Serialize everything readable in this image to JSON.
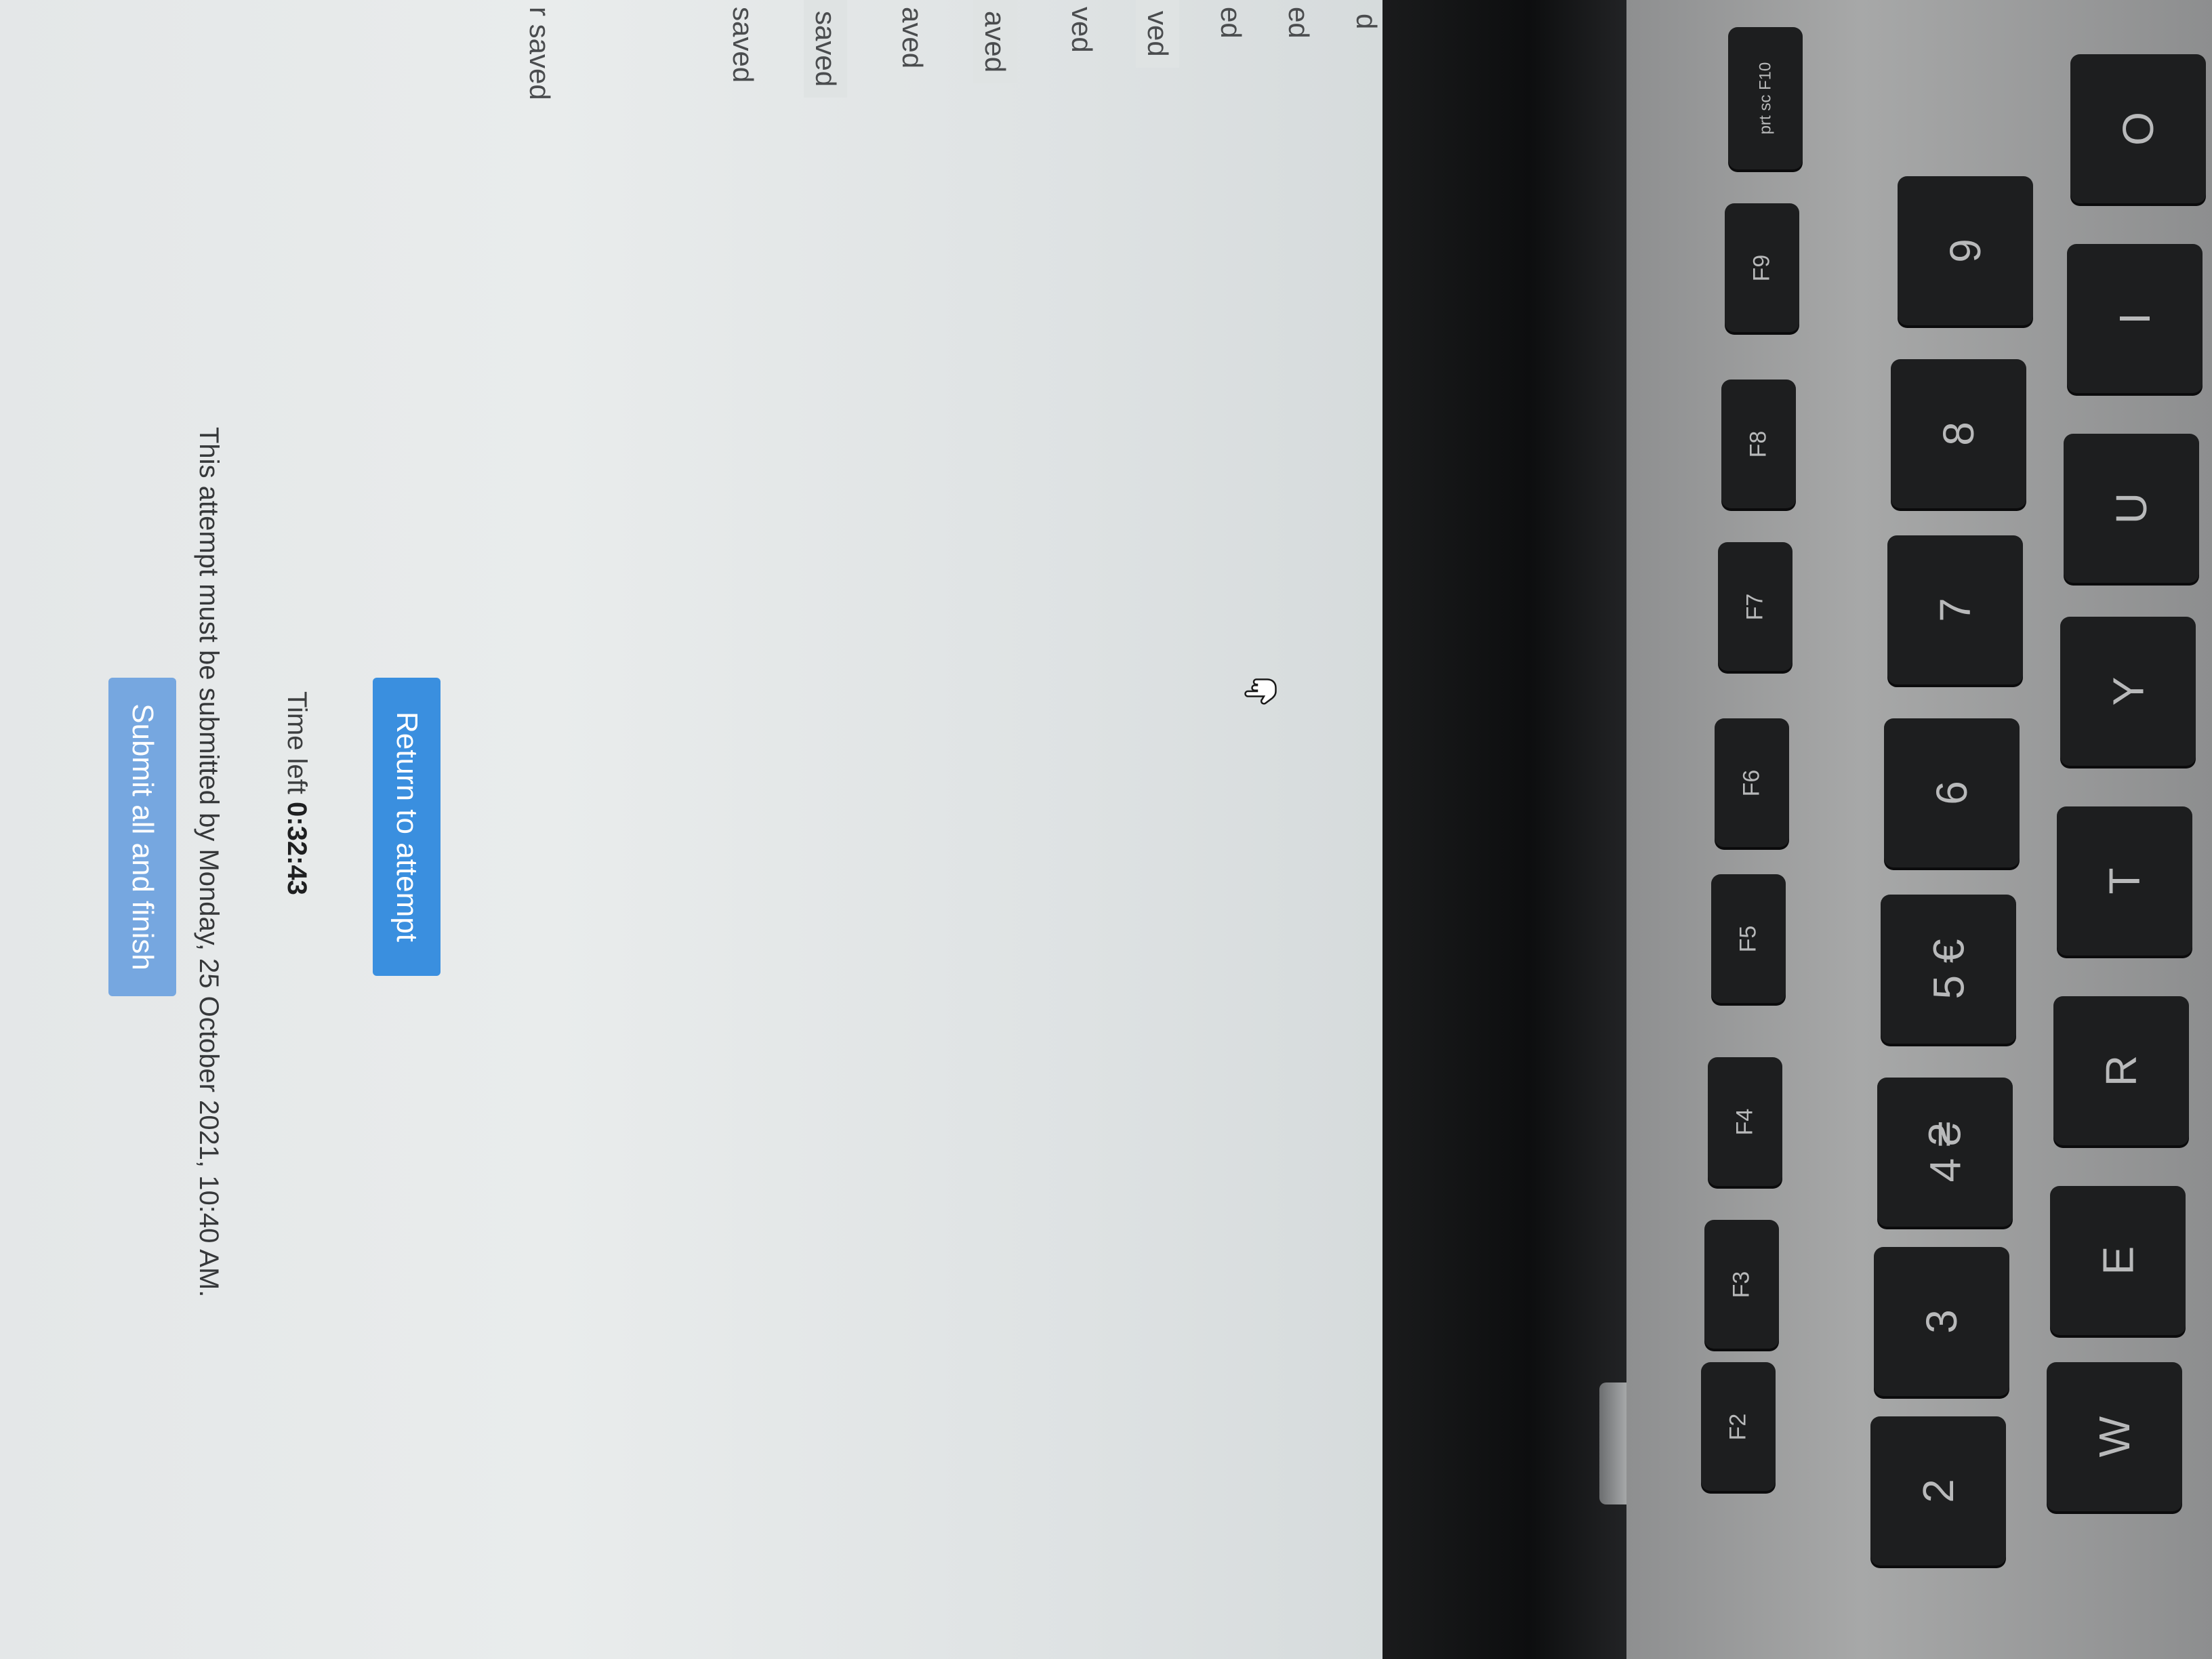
{
  "sidebar": {
    "items": [
      "d",
      "ed",
      "ed",
      "ved",
      "ved",
      "aved",
      "aved",
      "saved",
      "saved",
      "r saved"
    ]
  },
  "main": {
    "return_button": "Return to attempt",
    "time_left_label": "Time left",
    "time_left_value": "0:32:43",
    "submit_button": "Submit all and finish",
    "deadline_text": "This attempt must be submitted by Monday, 25 October 2021, 10:40 AM."
  },
  "keyboard": {
    "fn_row": [
      "F2",
      "F3",
      "F4",
      "F5",
      "F6",
      "F7",
      "F8",
      "F9",
      "prt sc F10"
    ],
    "number_row": [
      {
        "top": "@",
        "bottom": "2"
      },
      {
        "top": "#",
        "bottom": "3"
      },
      {
        "top": "$",
        "bottom": "4 ₴"
      },
      {
        "top": "%",
        "bottom": "5 €"
      },
      {
        "top": "^",
        "bottom": "6"
      },
      {
        "top": "&",
        "bottom": "7"
      },
      {
        "top": "*",
        "bottom": "8"
      },
      {
        "top": "(",
        "bottom": "9"
      }
    ],
    "letter_row": [
      "W",
      "E",
      "R",
      "T",
      "Y",
      "U",
      "I",
      "O"
    ]
  },
  "colors": {
    "primary_button": "#3a8fdf",
    "submit_button": "#76a7e0",
    "screen_bg": "#e6e9ea"
  }
}
